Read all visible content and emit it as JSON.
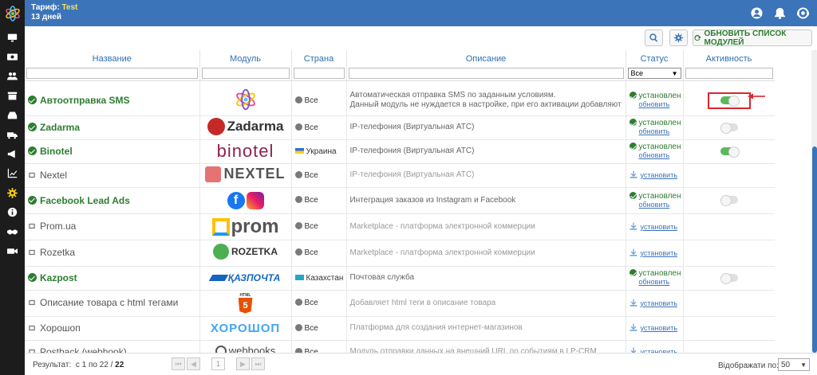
{
  "header": {
    "tariff_label": "Тариф:",
    "tariff_name": "Test",
    "days": "13 дней"
  },
  "toolbar": {
    "refresh_label": "ОБНОВИТЬ СПИСОК МОДУЛЕЙ"
  },
  "columns": {
    "name": "Название",
    "module": "Модуль",
    "country": "Страна",
    "description": "Описание",
    "status": "Статус",
    "activity": "Активность"
  },
  "filters": {
    "status_selected": "Все"
  },
  "status_labels": {
    "installed": "установлен",
    "update": "обновить",
    "install": "установить"
  },
  "rows": [
    {
      "name": "Автоотправка SMS",
      "installed": true,
      "logo": "sms-atom",
      "logo_text": "",
      "country": "Все",
      "country_icon": "globe",
      "desc1": "Автоматическая отправка SMS по заданным условиям.",
      "desc2": "Данный модуль не нуждается в настройке, при его активации добавляют",
      "active": true,
      "highlight": true
    },
    {
      "name": "Zadarma",
      "installed": true,
      "logo": "zadarma",
      "logo_text": "Zadarma",
      "country": "Все",
      "country_icon": "globe",
      "desc1": "IP-телефония (Виртуальная АТС)",
      "desc2": "",
      "active": false
    },
    {
      "name": "Binotel",
      "installed": true,
      "logo": "binotel",
      "logo_text": "binotel",
      "country": "Украина",
      "country_icon": "flag-ua",
      "desc1": "IP-телефония (Виртуальная АТС)",
      "desc2": "",
      "active": true
    },
    {
      "name": "Nextel",
      "installed": false,
      "logo": "nextel",
      "logo_text": "NEXTEL",
      "country": "Все",
      "country_icon": "globe",
      "desc1": "IP-телефония (Виртуальная АТС)",
      "desc2": ""
    },
    {
      "name": "Facebook Lead Ads",
      "installed": true,
      "logo": "facebook-instagram",
      "logo_text": "",
      "country": "Все",
      "country_icon": "globe",
      "desc1": "Интеграция заказов из Instagram и Facebook",
      "desc2": "",
      "active": false
    },
    {
      "name": "Prom.ua",
      "installed": false,
      "logo": "prom",
      "logo_text": "prom",
      "country": "Все",
      "country_icon": "globe",
      "desc1": "Marketplace - платформа электронной коммерции",
      "desc2": ""
    },
    {
      "name": "Rozetka",
      "installed": false,
      "logo": "rozetka",
      "logo_text": "ROZETKA",
      "country": "Все",
      "country_icon": "globe",
      "desc1": "Marketplace - платформа электронной коммерции",
      "desc2": ""
    },
    {
      "name": "Kazpost",
      "installed": true,
      "logo": "kazpost",
      "logo_text": "ҚАЗПОЧТА",
      "country": "Казахстан",
      "country_icon": "flag-kz",
      "desc1": "Почтовая служба",
      "desc2": "",
      "active": false
    },
    {
      "name": "Описание товара с html тегами",
      "installed": false,
      "logo": "html5",
      "logo_text": "HTML",
      "country": "Все",
      "country_icon": "globe",
      "desc1": "Добавляет html теги в описание товара",
      "desc2": ""
    },
    {
      "name": "Хорошоп",
      "installed": false,
      "logo": "horoshop",
      "logo_text": "ХОРОШОП",
      "country": "Все",
      "country_icon": "globe",
      "desc1": "Платформа для создания интернет-магазинов",
      "desc2": ""
    },
    {
      "name": "Postback (webhook)",
      "installed": false,
      "logo": "webhooks",
      "logo_text": "webhooks",
      "country": "Все",
      "country_icon": "globe",
      "desc1": "Модуль отправки данных на внешний URL по событиям в LP-CRM",
      "desc2": ""
    }
  ],
  "footer": {
    "result_label": "Результат:",
    "result_range": "с 1 по 22 /",
    "result_total": "22",
    "page": "1",
    "show_label": "Відображати по:",
    "per_page": "50"
  },
  "colors": {
    "header_bg": "#3b74b8",
    "sidebar_bg": "#1c1c1c",
    "installed_green": "#2e7d32",
    "toggle_on": "#5cb85c",
    "highlight_red": "#d9262c",
    "tariff_yellow": "#f6e05e"
  }
}
